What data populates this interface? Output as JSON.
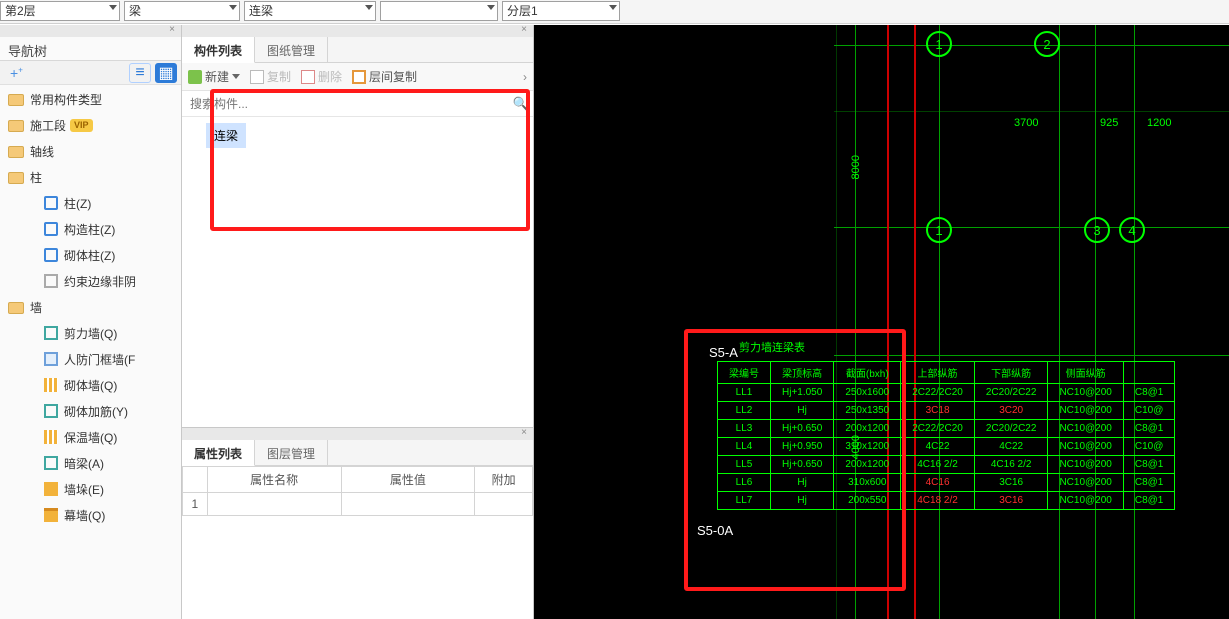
{
  "top_combos": {
    "floor": "第2层",
    "cat": "梁",
    "type": "连梁",
    "blank": "",
    "layer": "分层1"
  },
  "nav": {
    "title": "导航树",
    "groups": [
      {
        "label": "常用构件类型"
      },
      {
        "label": "施工段",
        "vip": "VIP"
      },
      {
        "label": "轴线"
      },
      {
        "label": "柱",
        "children": [
          {
            "label": "柱(Z)",
            "icon": "ic-blue"
          },
          {
            "label": "构造柱(Z)",
            "icon": "ic-blue"
          },
          {
            "label": "砌体柱(Z)",
            "icon": "ic-blue"
          },
          {
            "label": "约束边缘非阴",
            "icon": "ic-grey"
          }
        ]
      },
      {
        "label": "墙",
        "children": [
          {
            "label": "剪力墙(Q)",
            "icon": "ic-teal"
          },
          {
            "label": "人防门框墙(F",
            "icon": "ic-box"
          },
          {
            "label": "砌体墙(Q)",
            "icon": "ic-yel"
          },
          {
            "label": "砌体加筋(Y)",
            "icon": "ic-teal"
          },
          {
            "label": "保温墙(Q)",
            "icon": "ic-yel"
          },
          {
            "label": "暗梁(A)",
            "icon": "ic-teal"
          },
          {
            "label": "墙垛(E)",
            "icon": "ic-orange"
          },
          {
            "label": "幕墙(Q)",
            "icon": "ic-orange2"
          }
        ]
      }
    ]
  },
  "mid": {
    "tabs": {
      "list": "构件列表",
      "draw": "图纸管理"
    },
    "tool": {
      "new": "新建",
      "copy": "复制",
      "del": "删除",
      "floor_copy": "层间复制"
    },
    "search_ph": "搜索构件...",
    "items": [
      {
        "label": "连梁"
      }
    ],
    "prop": {
      "tabs": {
        "prop": "属性列表",
        "layer": "图层管理"
      },
      "cols": {
        "name": "属性名称",
        "val": "属性值",
        "add": "附加"
      }
    }
  },
  "cad": {
    "bubbles": {
      "top": [
        "1",
        "2"
      ],
      "mid": [
        "1",
        "3",
        "4"
      ]
    },
    "dims": {
      "w1": "3700",
      "w2": "925",
      "w3": "1200",
      "h1": "8000",
      "h2": "4000"
    },
    "labels": {
      "s5a": "S5-A",
      "s50a": "S5-0A",
      "tbl_title": "剪力墙连梁表"
    },
    "table": {
      "head": [
        "梁编号",
        "梁顶标高",
        "截面(bxh)",
        "上部纵筋",
        "下部纵筋",
        "侧面纵筋",
        ""
      ],
      "rows": [
        [
          "LL1",
          "Hj+1.050",
          "250x1600",
          "2C22/2C20",
          "2C20/2C22",
          "NC10@200",
          "C8@1"
        ],
        [
          "LL2",
          "Hj",
          "250x1350",
          "3C18",
          "3C20",
          "NC10@200",
          "C10@"
        ],
        [
          "LL3",
          "Hj+0.650",
          "200x1200",
          "2C22/2C20",
          "2C20/2C22",
          "NC10@200",
          "C8@1"
        ],
        [
          "LL4",
          "Hj+0.950",
          "310x1200",
          "4C22",
          "4C22",
          "NC10@200",
          "C10@"
        ],
        [
          "LL5",
          "Hj+0.650",
          "200x1200",
          "4C16 2/2",
          "4C16 2/2",
          "NC10@200",
          "C8@1"
        ],
        [
          "LL6",
          "Hj",
          "310x600",
          "4C16",
          "3C16",
          "NC10@200",
          "C8@1"
        ],
        [
          "LL7",
          "Hj",
          "200x550",
          "4C18 2/2",
          "3C16",
          "NC10@200",
          "C8@1"
        ]
      ],
      "red_cells": [
        [
          1,
          3
        ],
        [
          1,
          4
        ],
        [
          5,
          3
        ],
        [
          6,
          3
        ],
        [
          6,
          4
        ]
      ]
    }
  }
}
